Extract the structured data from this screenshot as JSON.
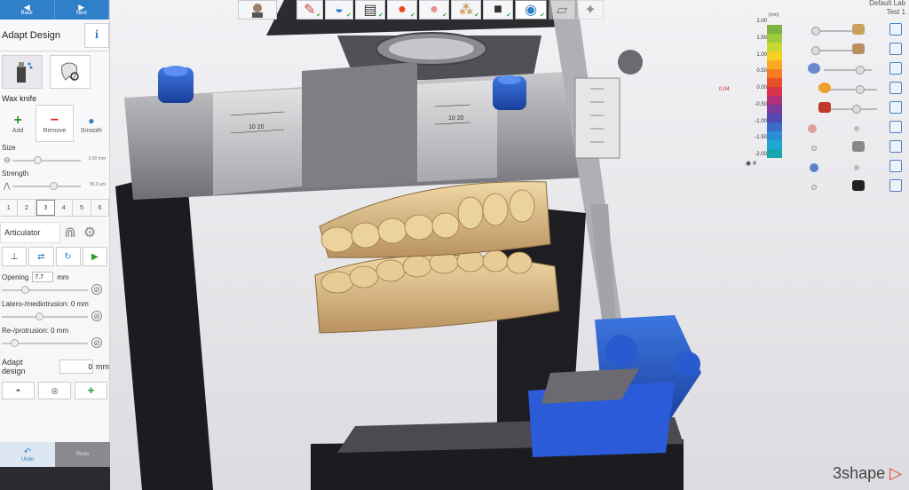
{
  "nav": {
    "back_label": "Back",
    "next_label": "Next"
  },
  "panel": {
    "title": "Adapt Design",
    "info_label": "i",
    "wax_knife_label": "Wax knife",
    "add_label": "Add",
    "remove_label": "Remove",
    "smooth_label": "Smooth",
    "size_label": "Size",
    "size_value": "3.00 mm",
    "strength_label": "Strength",
    "strength_value": "30.0 µm",
    "tabs": [
      "1",
      "2",
      "3",
      "4",
      "5",
      "6"
    ],
    "selected_tab": "3",
    "articulator_label": "Articulator",
    "opening_label": "Opening",
    "opening_value": "7.7",
    "opening_unit": "mm",
    "latero_label": "Latero-/mediotrusion: 0 mm",
    "protrusion_label": "Re-/protrusion: 0 mm",
    "adapt_design_label": "Adapt design",
    "adapt_design_value": "0",
    "adapt_design_unit": "mm",
    "undo_label": "Undo",
    "redo_label": "Redo"
  },
  "topright": {
    "line1": "Default Lab",
    "line2": "Test 1"
  },
  "colorscale": {
    "unit": "[mm]",
    "ticks": [
      "2.00",
      "1.50",
      "1.00",
      "0.50",
      "0.00",
      "-0.50",
      "-1.00",
      "-1.50",
      "-2.00"
    ],
    "marker": "0.04",
    "hash_label": "#",
    "colors": [
      "#7cb342",
      "#9ccc3c",
      "#c8d832",
      "#f4d21f",
      "#f9a825",
      "#f57c20",
      "#e8502a",
      "#d8344a",
      "#b0307a",
      "#7a3b9a",
      "#5148b0",
      "#3a6cc8",
      "#2c8ed8",
      "#20a8d0",
      "#1aa4b0"
    ]
  },
  "brand": "3shape",
  "colors": {
    "accent": "#2f7fc9",
    "play": "#2a9a2a",
    "remove": "#d62b2b",
    "add": "#2a9a2a"
  }
}
